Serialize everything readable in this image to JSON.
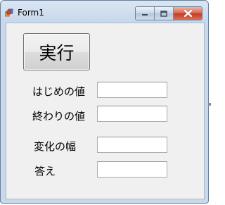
{
  "window": {
    "title": "Form1",
    "icons": {
      "app": "form-app-icon",
      "minimize": "minimize-icon",
      "maximize": "maximize-icon",
      "close": "close-icon"
    }
  },
  "form": {
    "run_button_label": "実行",
    "fields": [
      {
        "label": "はじめの値",
        "value": ""
      },
      {
        "label": "終わりの値",
        "value": ""
      },
      {
        "label": "変化の幅",
        "value": ""
      },
      {
        "label": "答え",
        "value": ""
      }
    ]
  },
  "colors": {
    "titlebar": "#c9d8ea",
    "client": "#f0f0f0",
    "close_button": "#c43b22"
  }
}
